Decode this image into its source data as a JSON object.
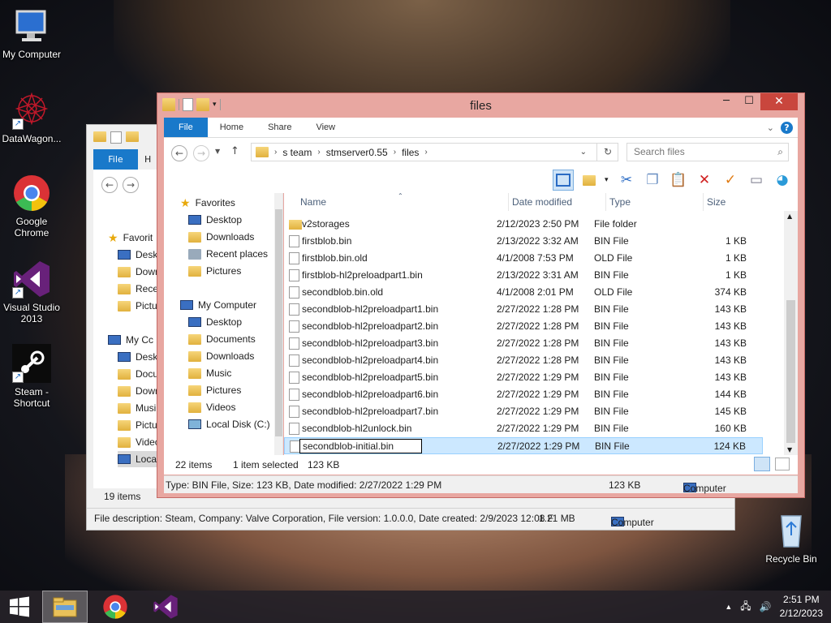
{
  "desktop": {
    "icons": [
      {
        "label": "My Computer",
        "icon": "computer-icon"
      },
      {
        "label": "DataWagon...",
        "icon": "datawagon-icon"
      },
      {
        "label": "Google Chrome",
        "icon": "chrome-icon"
      },
      {
        "label": "Visual Studio 2013",
        "icon": "visual-studio-icon"
      },
      {
        "label": "Steam - Shortcut",
        "icon": "steam-icon"
      },
      {
        "label": "Recycle Bin",
        "icon": "recycle-bin-icon"
      }
    ]
  },
  "back_window": {
    "tab_file": "File",
    "tab_home_partial": "H",
    "nav_items": [
      "Favorit",
      "Deskt",
      "Dowr",
      "Recer",
      "Pictu",
      "My Cc",
      "Deskt",
      "Docu",
      "Dowr",
      "Musi",
      "Pictu",
      "Videc",
      "Local"
    ],
    "item_count": "19 items",
    "status_description": "File description: Steam, Company: Valve Corporation, File version: 1.0.0.0, Date created: 2/9/2023 12:08 F",
    "status_size": "1.21 MB",
    "status_location": "Computer"
  },
  "window": {
    "title": "files",
    "tabs": {
      "file": "File",
      "home": "Home",
      "share": "Share",
      "view": "View"
    },
    "breadcrumb": [
      "s team",
      "stmserver0.55",
      "files"
    ],
    "search_placeholder": "Search files",
    "nav_pane": {
      "favorites_label": "Favorites",
      "favorites": [
        "Desktop",
        "Downloads",
        "Recent places",
        "Pictures"
      ],
      "computer_label": "My Computer",
      "computer": [
        "Desktop",
        "Documents",
        "Downloads",
        "Music",
        "Pictures",
        "Videos",
        "Local Disk (C:)"
      ]
    },
    "columns": {
      "name": "Name",
      "date": "Date modified",
      "type": "Type",
      "size": "Size"
    },
    "files": [
      {
        "name": "v2storages",
        "date": "2/12/2023 2:50 PM",
        "type": "File folder",
        "size": "",
        "folder": true
      },
      {
        "name": "firstblob.bin",
        "date": "2/13/2022 3:32 AM",
        "type": "BIN File",
        "size": "1 KB"
      },
      {
        "name": "firstblob.bin.old",
        "date": "4/1/2008 7:53 PM",
        "type": "OLD File",
        "size": "1 KB"
      },
      {
        "name": "firstblob-hl2preloadpart1.bin",
        "date": "2/13/2022 3:31 AM",
        "type": "BIN File",
        "size": "1 KB"
      },
      {
        "name": "secondblob.bin.old",
        "date": "4/1/2008 2:01 PM",
        "type": "OLD File",
        "size": "374 KB"
      },
      {
        "name": "secondblob-hl2preloadpart1.bin",
        "date": "2/27/2022 1:28 PM",
        "type": "BIN File",
        "size": "143 KB"
      },
      {
        "name": "secondblob-hl2preloadpart2.bin",
        "date": "2/27/2022 1:28 PM",
        "type": "BIN File",
        "size": "143 KB"
      },
      {
        "name": "secondblob-hl2preloadpart3.bin",
        "date": "2/27/2022 1:28 PM",
        "type": "BIN File",
        "size": "143 KB"
      },
      {
        "name": "secondblob-hl2preloadpart4.bin",
        "date": "2/27/2022 1:28 PM",
        "type": "BIN File",
        "size": "143 KB"
      },
      {
        "name": "secondblob-hl2preloadpart5.bin",
        "date": "2/27/2022 1:29 PM",
        "type": "BIN File",
        "size": "143 KB"
      },
      {
        "name": "secondblob-hl2preloadpart6.bin",
        "date": "2/27/2022 1:29 PM",
        "type": "BIN File",
        "size": "144 KB"
      },
      {
        "name": "secondblob-hl2preloadpart7.bin",
        "date": "2/27/2022 1:29 PM",
        "type": "BIN File",
        "size": "145 KB"
      },
      {
        "name": "secondblob-hl2unlock.bin",
        "date": "2/27/2022 1:29 PM",
        "type": "BIN File",
        "size": "160 KB"
      },
      {
        "name": "secondblob-initial.bin",
        "date": "2/27/2022 1:29 PM",
        "type": "BIN File",
        "size": "124 KB",
        "selected": true,
        "renaming": true
      }
    ],
    "status": {
      "item_count": "22 items",
      "selected": "1 item selected",
      "selected_size": "123 KB",
      "details": "Type: BIN File, Size: 123 KB, Date modified: 2/27/2022 1:29 PM",
      "details_size": "123 KB",
      "location": "Computer"
    }
  },
  "taskbar": {
    "apps": [
      "file-explorer",
      "google-chrome",
      "visual-studio"
    ],
    "clock_time": "2:51 PM",
    "clock_date": "2/12/2023"
  },
  "colors": {
    "accent": "#1979ca",
    "window_frame": "#e8a7a1",
    "close": "#c9463d",
    "selection": "#cce8ff"
  }
}
